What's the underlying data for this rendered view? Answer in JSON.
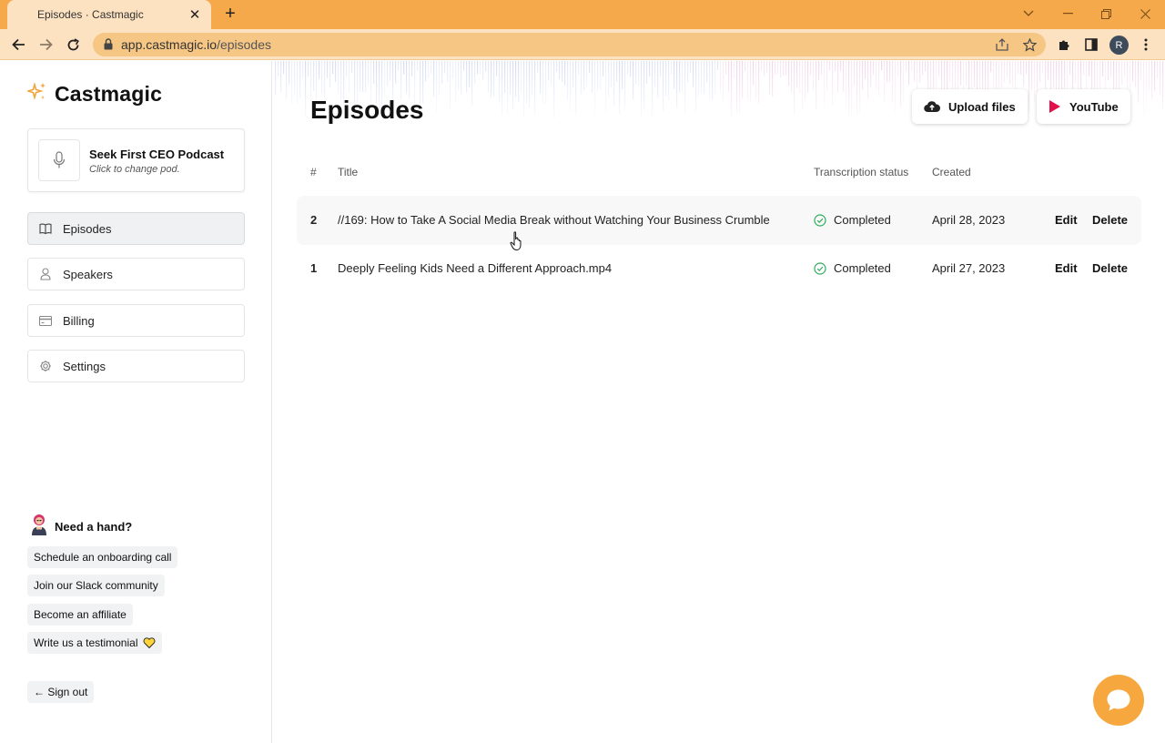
{
  "browser": {
    "tab_title": "Episodes · Castmagic",
    "url_host": "app.castmagic.io",
    "url_path": "/episodes",
    "profile_initial": "R",
    "colors": {
      "tabbar": "#f5a94b",
      "toolbar": "#fde2c1"
    }
  },
  "sidebar": {
    "brand": "Castmagic",
    "podcast": {
      "name": "Seek First CEO Podcast",
      "hint": "Click to change pod."
    },
    "nav": [
      {
        "label": "Episodes",
        "icon": "book-icon",
        "active": true
      },
      {
        "label": "Speakers",
        "icon": "user-icon",
        "active": false
      },
      {
        "label": "Billing",
        "icon": "credit-card-icon",
        "active": false
      },
      {
        "label": "Settings",
        "icon": "gear-icon",
        "active": false
      }
    ],
    "help": {
      "title": "Need a hand?",
      "links": [
        "Schedule an onboarding call",
        "Join our Slack community",
        "Become an affiliate",
        "Write us a testimonial"
      ]
    },
    "sign_out": "← Sign out"
  },
  "main": {
    "title": "Episodes",
    "upload_label": "Upload files",
    "youtube_label": "YouTube",
    "columns": {
      "num": "#",
      "title": "Title",
      "status": "Transcription status",
      "created": "Created"
    },
    "episodes": [
      {
        "num": "2",
        "title": "//169:  How to Take A Social Media Break without Watching Your Business Crumble",
        "status": "Completed",
        "created": "April 28, 2023",
        "edit": "Edit",
        "delete": "Delete"
      },
      {
        "num": "1",
        "title": "Deeply Feeling Kids Need a Different Approach.mp4",
        "status": "Completed",
        "created": "April 27, 2023",
        "edit": "Edit",
        "delete": "Delete"
      }
    ],
    "colors": {
      "accent": "#f6a83e",
      "youtube": "#e0114b",
      "status_ok": "#2fae5b"
    }
  }
}
